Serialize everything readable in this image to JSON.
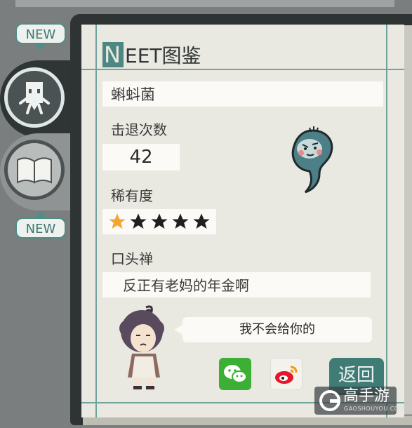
{
  "tabs": {
    "new_badge_top": "NEW",
    "new_badge_bottom": "NEW",
    "tab1_icon": "neet-creature-icon",
    "tab2_icon": "book-icon"
  },
  "title": {
    "first_letter": "N",
    "rest": "EET图鉴"
  },
  "entry": {
    "name": "蝌蚪菌",
    "defeat_label": "击退次数",
    "defeat_count": "42",
    "rarity_label": "稀有度",
    "rarity_value": 1,
    "rarity_max": 5,
    "catchphrase_label": "口头禅",
    "catchphrase": "反正有老妈的年金啊"
  },
  "dialogue": {
    "speech": "我不会给你的"
  },
  "share": {
    "wechat_icon": "wechat-icon",
    "weibo_icon": "weibo-icon"
  },
  "buttons": {
    "back": "返回"
  },
  "watermark": {
    "text": "高手游",
    "sub": "GAOSHOUYOU.COM"
  },
  "colors": {
    "accent": "#3f7c75",
    "star_filled": "#f2a531",
    "star_empty": "#1f1f1f",
    "page": "#e9e8e1"
  }
}
